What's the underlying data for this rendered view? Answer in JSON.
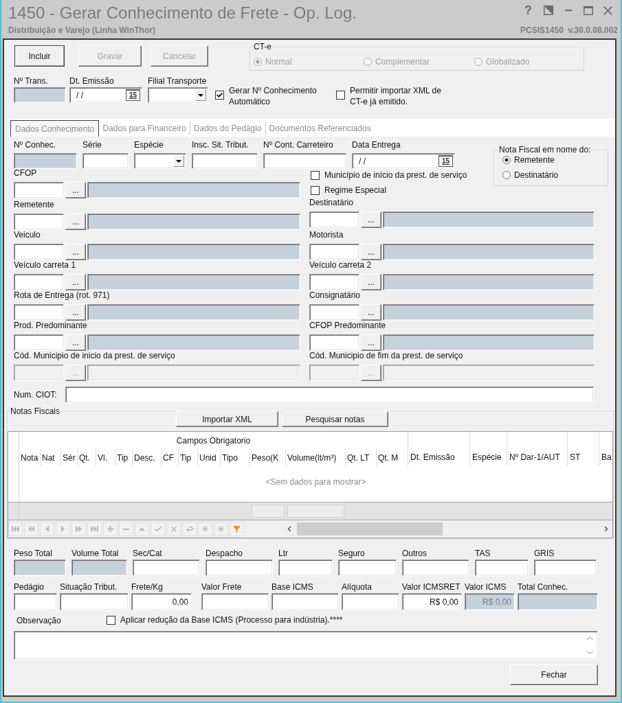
{
  "window": {
    "title": "1450 - Gerar Conhecimento de Frete - Op. Log.",
    "subtitle": "Distribuição e Varejo (Linha WinThor)",
    "help": "?",
    "version": "PCSIS1450  v.30.0.08.002"
  },
  "actions": [
    {
      "label": "Incluir",
      "disabled": false
    },
    {
      "label": "Gravar",
      "disabled": true
    },
    {
      "label": "Cancelar",
      "disabled": true
    }
  ],
  "cte": {
    "legend": "CT-e",
    "options": [
      {
        "label": "Normal",
        "selected": true,
        "disabled": true
      },
      {
        "label": "Complementar",
        "selected": false,
        "disabled": true
      },
      {
        "label": "Globalizado",
        "selected": false,
        "disabled": true
      }
    ]
  },
  "header_fields": [
    {
      "kind": "readonly",
      "label": "Nº Trans."
    },
    {
      "kind": "date",
      "label": "Dt. Emissão",
      "value": "/ /",
      "button": "15"
    },
    {
      "kind": "combo",
      "label": "Filial Transporte"
    }
  ],
  "header_checks": [
    {
      "label": "Gerar Nº Conhecimento Automático",
      "checked": true
    },
    {
      "label": "Permitir importar XML de CT-e já emitido.",
      "checked": false
    }
  ],
  "tabs": [
    {
      "label": "Dados Conhecimento",
      "selected": true
    },
    {
      "label": "Dados para Financeiro",
      "selected": false
    },
    {
      "label": "Dados do Pedágio",
      "selected": false
    },
    {
      "label": "Documentos Referenciados",
      "selected": false
    }
  ],
  "conhecimento": {
    "fields": [
      {
        "kind": "readonly",
        "label": "Nº Conhec."
      },
      {
        "kind": "text",
        "label": "Série"
      },
      {
        "kind": "combo",
        "label": "Espécie"
      },
      {
        "kind": "text",
        "label": "Insc. Sit. Tribut."
      },
      {
        "kind": "text",
        "label": "Nº Cont. Carreteiro"
      },
      {
        "kind": "date",
        "label": "Data Entrega",
        "value": "/ /",
        "button": "15"
      }
    ],
    "nota_fiscal_em_nome": {
      "legend": "Nota Fiscal em nome do:",
      "options": [
        {
          "label": "Remetente",
          "selected": true
        },
        {
          "label": "Destinatário",
          "selected": false
        }
      ]
    },
    "checks": [
      {
        "label": "Município de início da prest. de serviço",
        "checked": false
      },
      {
        "label": "Regime Especial",
        "checked": false
      }
    ],
    "lookups_left": [
      {
        "label": "CFOP",
        "button": "...",
        "disabled": false
      },
      {
        "label": "Remetente",
        "button": "...",
        "disabled": false
      },
      {
        "label": "Veiculo",
        "button": "...",
        "disabled": false
      },
      {
        "label": "Veículo carreta 1",
        "button": "...",
        "disabled": false
      },
      {
        "label": "Rota de Entrega (rot. 971)",
        "button": "...",
        "disabled": false
      },
      {
        "label": "Prod. Predominante",
        "button": "...",
        "disabled": false
      },
      {
        "label": "Cód. Municipio de inicio da prest. de serviço",
        "button": "...",
        "disabled": true
      }
    ],
    "lookups_right": [
      {
        "label": "Destinatário",
        "button": "...",
        "disabled": false
      },
      {
        "label": "Motorista",
        "button": "...",
        "disabled": false
      },
      {
        "label": "Veículo carreta 2",
        "button": "...",
        "disabled": false
      },
      {
        "label": "Consignatário",
        "button": "...",
        "disabled": false
      },
      {
        "label": "CFOP Predominante",
        "button": "...",
        "disabled": false
      },
      {
        "label": "Cód. Municipio de fim da prest. de serviço",
        "button": "...",
        "disabled": true
      }
    ],
    "ciot": {
      "label": "Num. CIOT:"
    }
  },
  "notas_fiscais": {
    "legend": "Notas Fiscais",
    "buttons": [
      "Importar XML",
      "Pesquisar notas"
    ],
    "grid": {
      "band": "Campos Obrigatorio",
      "band_columns": [
        {
          "label": "Nota",
          "summary": false
        },
        {
          "label": "Nat",
          "summary": false
        },
        {
          "label": "Sér",
          "summary": false
        },
        {
          "label": "Qt.",
          "summary": false
        },
        {
          "label": "Vl.",
          "summary": false
        },
        {
          "label": "Tip",
          "summary": false
        },
        {
          "label": "Desc.",
          "summary": false
        },
        {
          "label": "CF",
          "summary": false
        },
        {
          "label": "Tip",
          "summary": false
        },
        {
          "label": "Unid",
          "summary": false
        },
        {
          "label": "Tipo",
          "summary": false
        },
        {
          "label": "Peso(K",
          "summary": true
        },
        {
          "label": "Volume(lt/m³)",
          "summary": true
        },
        {
          "label": "Qt. LT",
          "summary": false
        },
        {
          "label": "Qt. M",
          "summary": false
        }
      ],
      "columns": [
        {
          "label": "Dt. Emissão",
          "summary": false
        },
        {
          "label": "Espécie",
          "summary": false
        },
        {
          "label": "Nº Dar-1/AUT",
          "summary": false
        },
        {
          "label": "ST",
          "summary": false
        },
        {
          "label": "Ba",
          "summary": false
        }
      ],
      "empty_text": "<Sem dados para mostrar>",
      "navigator": [
        {
          "kind": "first",
          "disabled": true
        },
        {
          "kind": "prior_page",
          "disabled": true
        },
        {
          "kind": "prior",
          "disabled": true
        },
        {
          "kind": "next",
          "disabled": true
        },
        {
          "kind": "next_page",
          "disabled": true
        },
        {
          "kind": "last",
          "disabled": true
        },
        {
          "kind": "insert",
          "disabled": true
        },
        {
          "kind": "delete",
          "disabled": true
        },
        {
          "kind": "edit",
          "disabled": true
        },
        {
          "kind": "post",
          "disabled": true
        },
        {
          "kind": "cancel",
          "disabled": true
        },
        {
          "kind": "refresh",
          "disabled": true
        },
        {
          "kind": "set_bookmark",
          "disabled": true
        },
        {
          "kind": "goto_bookmark",
          "disabled": true
        },
        {
          "kind": "filter",
          "disabled": false
        }
      ]
    }
  },
  "totals": {
    "row_1": [
      {
        "kind": "readonly",
        "label": "Peso Total"
      },
      {
        "kind": "readonly",
        "label": "Volume Total"
      },
      {
        "kind": "text",
        "label": "Sec/Cat"
      },
      {
        "kind": "text",
        "label": "Despacho"
      },
      {
        "kind": "text",
        "label": "Ltr"
      },
      {
        "kind": "text",
        "label": "Seguro"
      },
      {
        "kind": "text",
        "label": "Outros"
      },
      {
        "kind": "text",
        "label": "TAS"
      },
      {
        "kind": "text",
        "label": "GRIS"
      }
    ],
    "row_2": [
      {
        "kind": "text",
        "label": "Pedágio"
      },
      {
        "kind": "text",
        "label": "Situação Tribut."
      },
      {
        "kind": "text",
        "label": "Frete/Kg",
        "value": "0,00"
      },
      {
        "kind": "text",
        "label": "Valor Frete"
      },
      {
        "kind": "text",
        "label": "Base ICMS"
      },
      {
        "kind": "text",
        "label": "Alíquota"
      },
      {
        "kind": "text",
        "label": "Valor ICMSRET",
        "value": "R$ 0,00"
      },
      {
        "kind": "readonly",
        "label": "Valor ICMS",
        "value": "R$ 0,00"
      },
      {
        "kind": "readonly",
        "label": "Total Conhec."
      }
    ]
  },
  "observacao": {
    "label": "Observação"
  },
  "reducao": {
    "label": "Aplicar redução da Base ICMS (Processo para indústria).****",
    "checked": false
  },
  "close_button": "Fechar"
}
